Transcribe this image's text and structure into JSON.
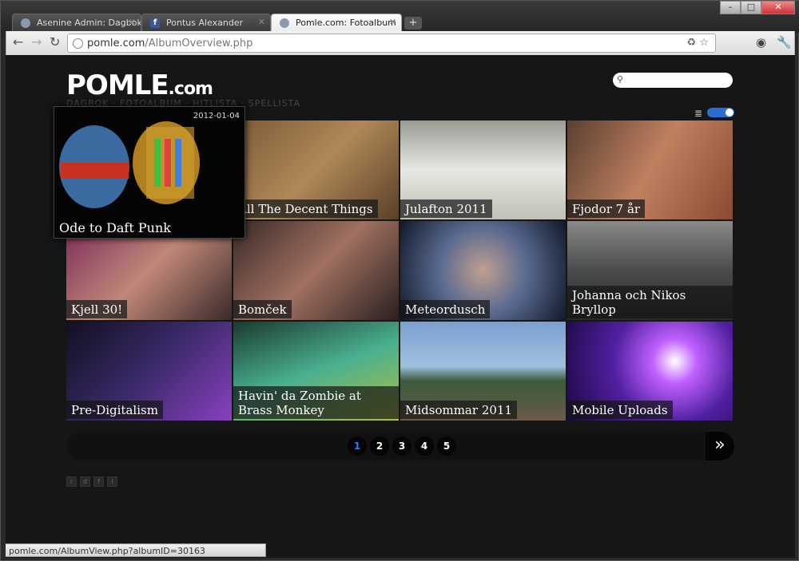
{
  "browser": {
    "tabs": [
      {
        "title": "Asenine Admin: Dagbok",
        "icon": "globe-icon"
      },
      {
        "title": "Pontus Alexander",
        "icon": "facebook-icon"
      },
      {
        "title": "Pomle.com: Fotoalbum",
        "icon": "globe-icon"
      }
    ],
    "new_tab": "+",
    "url_domain": "pomle.com",
    "url_path": "/AlbumOverview.php",
    "window_buttons": {
      "minimize": "–",
      "maximize": "□",
      "close": "✕"
    }
  },
  "site": {
    "logo_main": "POMLE",
    "logo_suffix": ".com",
    "subnav": "DAGBOK · FOTOALBUM · HITLISTA · SPELLISTA"
  },
  "popup": {
    "date": "2012-01-04",
    "title": "Ode to Daft Punk"
  },
  "albums": [
    {
      "title": "All The Decent Things",
      "color": "#a07a4a"
    },
    {
      "title": "Julafton 2011",
      "color": "#c8c8c0"
    },
    {
      "title": "Fjodor 7 år",
      "color": "#8a6a50"
    },
    {
      "title": "Kjell 30!",
      "color": "#6a3a4a"
    },
    {
      "title": "Bomček",
      "color": "#5a4a44"
    },
    {
      "title": "Meteordusch",
      "color": "#4a5a78"
    },
    {
      "title": "Johanna och Nikos Bryllop",
      "color": "#6a6a6a"
    },
    {
      "title": "Pre-Digitalism",
      "color": "#2a1a3a"
    },
    {
      "title": "Havin' da Zombie at Brass Monkey",
      "color": "#2a5a4a"
    },
    {
      "title": "Midsommar 2011",
      "color": "#6a8aa8"
    },
    {
      "title": "Mobile Uploads",
      "color": "#5a2aa8"
    }
  ],
  "pagination": {
    "pages": [
      "1",
      "2",
      "3",
      "4",
      "5"
    ],
    "current": "1",
    "next": "»"
  },
  "social_icons": [
    "rss-icon",
    "delicious-icon",
    "facebook-icon",
    "lastfm-icon"
  ],
  "status_text": "pomle.com/AlbumView.php?albumID=30163"
}
